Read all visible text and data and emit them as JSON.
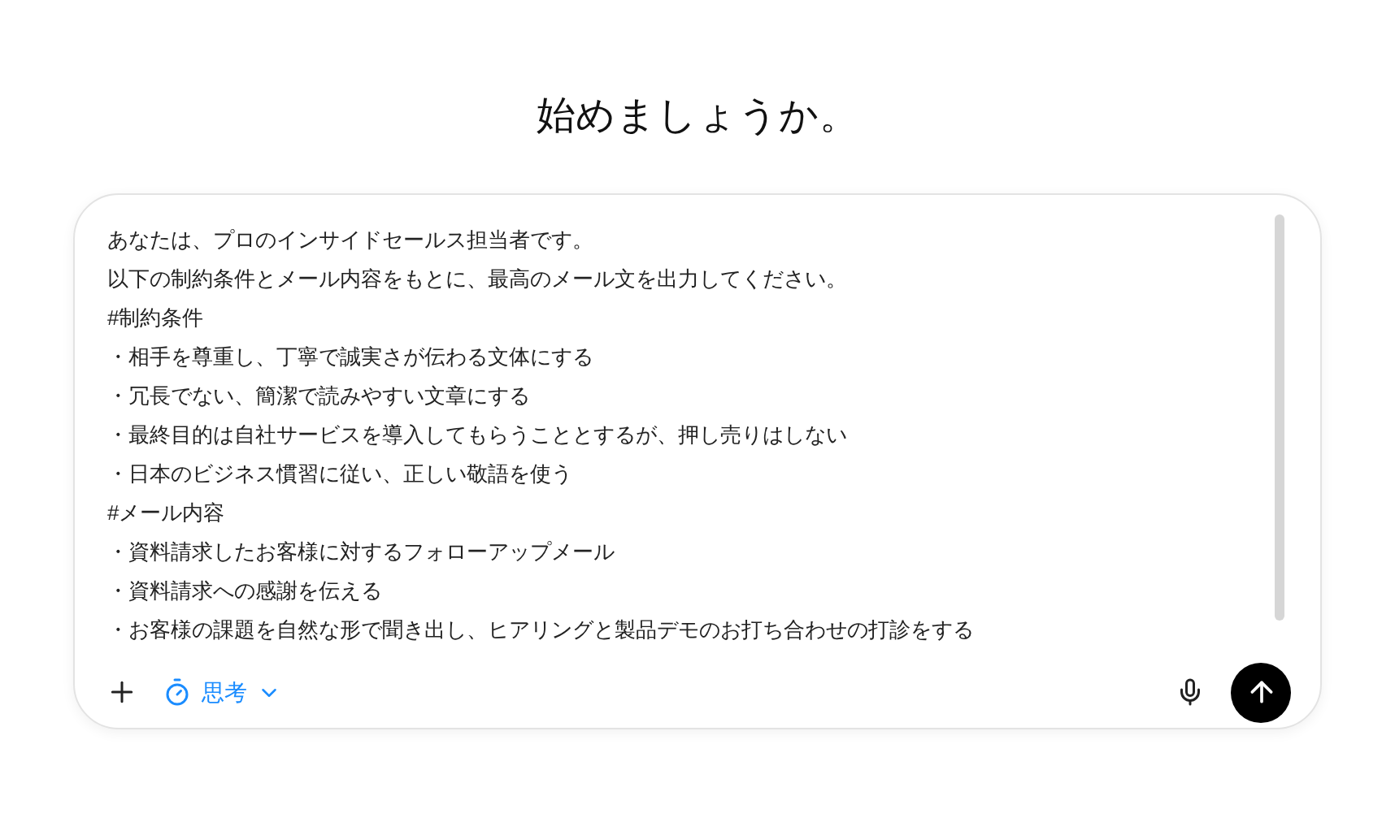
{
  "heading": "始めましょうか。",
  "composer": {
    "lines": [
      "あなたは、プロのインサイドセールス担当者です。",
      "以下の制約条件とメール内容をもとに、最高のメール文を出力してください。",
      "#制約条件",
      "・相手を尊重し、丁寧で誠実さが伝わる文体にする",
      "・冗長でない、簡潔で読みやすい文章にする",
      "・最終目的は自社サービスを導入してもらうこととするが、押し売りはしない",
      "・日本のビジネス慣習に従い、正しい敬語を使う",
      "#メール内容",
      "・資料請求したお客様に対するフォローアップメール",
      "・資料請求への感謝を伝える",
      "・お客様の課題を自然な形で聞き出し、ヒアリングと製品デモのお打ち合わせの打診をする"
    ],
    "think_toggle": {
      "label": "思考",
      "selected": true
    }
  }
}
